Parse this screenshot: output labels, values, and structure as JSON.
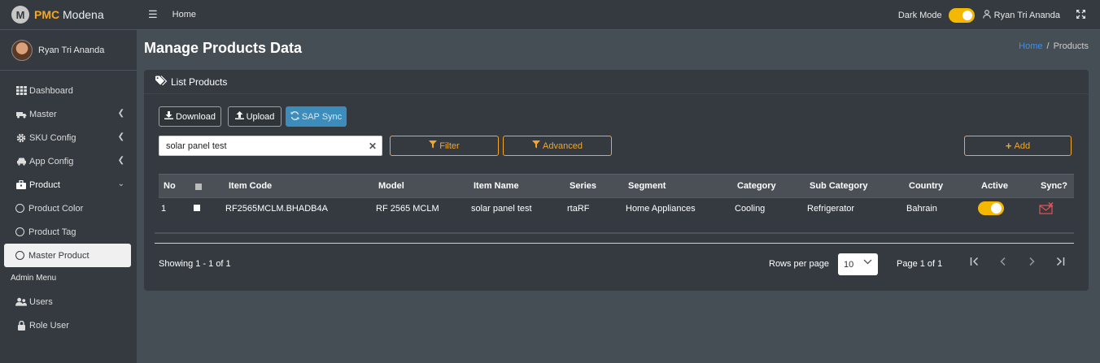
{
  "brand": {
    "logo_letter": "M",
    "name_bold": "PMC",
    "name_rest": " Modena"
  },
  "user": {
    "name": "Ryan Tri Ananda"
  },
  "sidebar": {
    "items": [
      {
        "label": "Dashboard",
        "icon": "grid-icon"
      },
      {
        "label": "Master",
        "icon": "truck-icon"
      },
      {
        "label": "SKU Config",
        "icon": "gear-icon"
      },
      {
        "label": "App Config",
        "icon": "car-icon"
      },
      {
        "label": "Product",
        "icon": "briefcase-icon"
      },
      {
        "label": "Product Color",
        "icon": "circle-icon"
      },
      {
        "label": "Product Tag",
        "icon": "circle-icon"
      },
      {
        "label": "Master Product",
        "icon": "circle-icon"
      }
    ],
    "admin_header": "Admin Menu",
    "admin_items": [
      {
        "label": "Users",
        "icon": "users-icon"
      },
      {
        "label": "Role User",
        "icon": "lock-icon"
      }
    ]
  },
  "topbar": {
    "home": "Home",
    "dark_mode_label": "Dark Mode",
    "user_name": "Ryan Tri Ananda"
  },
  "page": {
    "title": "Manage Products Data",
    "breadcrumb": {
      "home": "Home",
      "current": "Products"
    }
  },
  "card": {
    "title": "List Products",
    "buttons": {
      "download": "Download",
      "upload": "Upload",
      "sap_sync": "SAP Sync",
      "filter": "Filter",
      "advanced": "Advanced",
      "add": "Add"
    },
    "search": {
      "value": "solar panel test"
    }
  },
  "table": {
    "headers": [
      "No",
      "",
      "Item Code",
      "Model",
      "Item Name",
      "Series",
      "Segment",
      "Category",
      "Sub Category",
      "Country",
      "Active",
      "Sync?"
    ],
    "rows": [
      {
        "no": "1",
        "item_code": "RF2565MCLM.BHADB4A",
        "model": "RF 2565 MCLM",
        "item_name": "solar panel test",
        "series": "rtaRF",
        "segment": "Home Appliances",
        "category": "Cooling",
        "sub_category": "Refrigerator",
        "country": "Bahrain",
        "active": true
      }
    ]
  },
  "footer": {
    "showing": "Showing 1 - 1 of 1",
    "rows_per_page_label": "Rows per page",
    "rows_per_page_value": "10",
    "page_info": "Page 1 of 1"
  },
  "colors": {
    "accent": "#f5a623",
    "toggle": "#f5b800",
    "sync_blue": "#3c8dbc",
    "link": "#3f8fe8",
    "sync_icon": "#e05555"
  }
}
